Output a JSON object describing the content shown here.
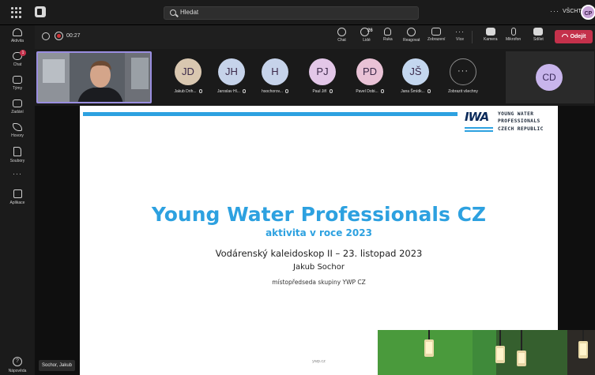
{
  "titlebar": {
    "search_placeholder": "Hledat",
    "more": "···",
    "org": "VŠCHT",
    "avatar_initials": "CP"
  },
  "rail": {
    "items": [
      {
        "label": "Aktivita",
        "icon": "bell-icon"
      },
      {
        "label": "Chat",
        "icon": "chat-icon",
        "badge": "1"
      },
      {
        "label": "Týmy",
        "icon": "teams-icon"
      },
      {
        "label": "Zadání",
        "icon": "assignments-icon"
      },
      {
        "label": "Hovory",
        "icon": "phone-icon"
      },
      {
        "label": "Soubory",
        "icon": "file-icon"
      }
    ],
    "more": "···",
    "apps_label": "Aplikace",
    "help_label": "Nápověda"
  },
  "meeting": {
    "timer": "00:27",
    "controls": [
      {
        "label": "Chat",
        "icon": "chat-icon"
      },
      {
        "label": "Lidé",
        "icon": "people-icon",
        "count": "26"
      },
      {
        "label": "Ruka",
        "icon": "hand-icon"
      },
      {
        "label": "Reagovat",
        "icon": "emoji-icon"
      },
      {
        "label": "Zobrazení",
        "icon": "view-icon"
      },
      {
        "label": "Více",
        "icon": "more-icon"
      },
      {
        "label": "Kamera",
        "icon": "camera-off-icon"
      },
      {
        "label": "Mikrofon",
        "icon": "mic-off-icon"
      },
      {
        "label": "Sdílet",
        "icon": "share-icon"
      }
    ],
    "leave_label": "Odejít"
  },
  "participants": [
    {
      "initials": "JD",
      "name": "Jakub Drih...",
      "color": "#d9c7b0"
    },
    {
      "initials": "JH",
      "name": "Jaroslav Hl...",
      "color": "#c6d3ea"
    },
    {
      "initials": "H",
      "name": "hsochorov...",
      "color": "#c6d3ea"
    },
    {
      "initials": "PJ",
      "name": "Paul Jiří",
      "color": "#e3c7e8"
    },
    {
      "initials": "PD",
      "name": "Pavel Dobi...",
      "color": "#e9c2d6"
    },
    {
      "initials": "JŠ",
      "name": "Jana Šmídk...",
      "color": "#c4d7ef"
    }
  ],
  "show_all": {
    "symbol": "···",
    "label": "Zobrazit všechny"
  },
  "cd_tile": {
    "initials": "CD"
  },
  "slide": {
    "logo_text": "IWA",
    "org_lines": [
      "YOUNG WATER",
      "PROFESSIONALS",
      "CZECH REPUBLIC"
    ],
    "title": "Young Water Professionals CZ",
    "subtitle": "aktivita v roce 2023",
    "event": "Vodárenský kaleidoskop II – 23. listopad 2023",
    "presenter": "Jakub Sochor",
    "role": "místopředseda skupiny YWP CZ",
    "footer": "ywp.cz"
  },
  "presenter_tag": "Sochor, Jakub",
  "colors": {
    "accent": "#2da1e0",
    "leave": "#c4314b",
    "speaker_border": "#9a8ee0"
  }
}
